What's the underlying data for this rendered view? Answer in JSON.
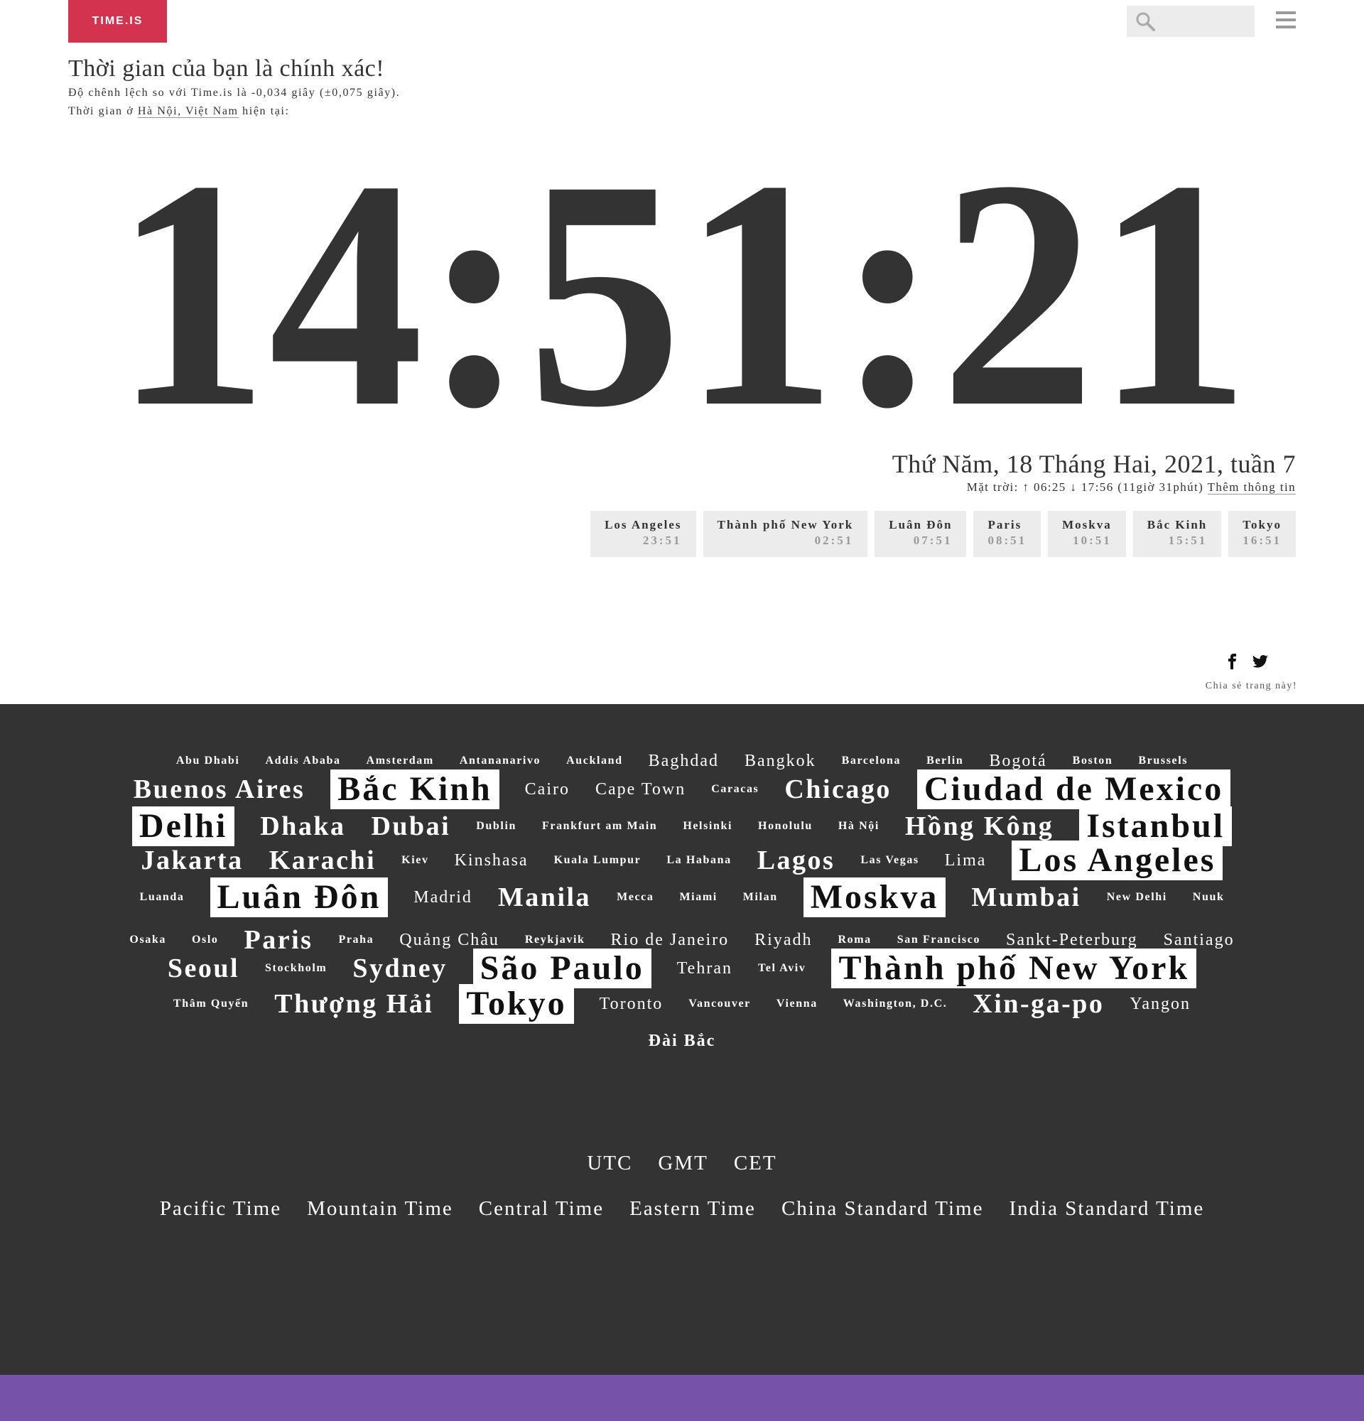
{
  "header": {
    "logo_text": "TIME.IS",
    "search_placeholder": ""
  },
  "status": {
    "title": "Thời gian của bạn là chính xác!",
    "offset_text": "Độ chênh lệch so với Time.is là -0,034 giây (±0,075 giây).",
    "location_prefix": "Thời gian ở",
    "location_link": "Hà Nội, Việt Nam",
    "location_suffix": "hiện tại:"
  },
  "clock": {
    "time": "14:51:21"
  },
  "date": {
    "date_text": "Thứ Năm, 18 Tháng Hai, 2021, tuần 7",
    "sun_text": "Mặt trời: ↑ 06:25 ↓ 17:56 (11giờ 31phút)",
    "more_info": "Thêm thông tin"
  },
  "world_clocks": [
    {
      "name": "Los Angeles",
      "time": "23:51"
    },
    {
      "name": "Thành phố New York",
      "time": "02:51"
    },
    {
      "name": "Luân Đôn",
      "time": "07:51"
    },
    {
      "name": "Paris",
      "time": "08:51"
    },
    {
      "name": "Moskva",
      "time": "10:51"
    },
    {
      "name": "Bắc Kinh",
      "time": "15:51"
    },
    {
      "name": "Tokyo",
      "time": "16:51"
    }
  ],
  "share": {
    "label": "Chia sẻ trang này!"
  },
  "city_cloud": {
    "rows": [
      [
        [
          "Abu Dhabi",
          "s1"
        ],
        [
          "Addis Ababa",
          "s1"
        ],
        [
          "Amsterdam",
          "s1"
        ],
        [
          "Antananarivo",
          "s1"
        ],
        [
          "Auckland",
          "s1"
        ],
        [
          "Baghdad",
          "s2"
        ],
        [
          "Bangkok",
          "s2"
        ],
        [
          "Barcelona",
          "s1"
        ],
        [
          "Berlin",
          "s1"
        ],
        [
          "Bogotá",
          "s2"
        ],
        [
          "Boston",
          "s1"
        ],
        [
          "Brussels",
          "s1"
        ]
      ],
      [
        [
          "Buenos Aires",
          "s3"
        ],
        [
          "Bắc Kinh",
          "big"
        ],
        [
          "Cairo",
          "s2"
        ],
        [
          "Cape Town",
          "s2"
        ],
        [
          "Caracas",
          "s1"
        ],
        [
          "Chicago",
          "s3"
        ],
        [
          "Ciudad de Mexico",
          "big"
        ]
      ],
      [
        [
          "Delhi",
          "big"
        ],
        [
          "Dhaka",
          "s3"
        ],
        [
          "Dubai",
          "s3"
        ],
        [
          "Dublin",
          "s1"
        ],
        [
          "Frankfurt am Main",
          "s1"
        ],
        [
          "Helsinki",
          "s1"
        ],
        [
          "Honolulu",
          "s1"
        ],
        [
          "Hà Nội",
          "s1"
        ],
        [
          "Hồng Kông",
          "s3"
        ],
        [
          "Istanbul",
          "big"
        ]
      ],
      [
        [
          "Jakarta",
          "s3"
        ],
        [
          "Karachi",
          "s3"
        ],
        [
          "Kiev",
          "s1"
        ],
        [
          "Kinshasa",
          "s2"
        ],
        [
          "Kuala Lumpur",
          "s1"
        ],
        [
          "La Habana",
          "s1"
        ],
        [
          "Lagos",
          "s3"
        ],
        [
          "Las Vegas",
          "s1"
        ],
        [
          "Lima",
          "s2"
        ],
        [
          "Los Angeles",
          "big"
        ]
      ],
      [
        [
          "Luanda",
          "s1"
        ],
        [
          "Luân Đôn",
          "big"
        ],
        [
          "Madrid",
          "s2"
        ],
        [
          "Manila",
          "s3"
        ],
        [
          "Mecca",
          "s1"
        ],
        [
          "Miami",
          "s1"
        ],
        [
          "Milan",
          "s1"
        ],
        [
          "Moskva",
          "big"
        ],
        [
          "Mumbai",
          "s3"
        ],
        [
          "New Delhi",
          "s1"
        ],
        [
          "Nuuk",
          "s1"
        ]
      ],
      [
        [
          "Osaka",
          "s1"
        ],
        [
          "Oslo",
          "s1"
        ],
        [
          "Paris",
          "s3"
        ],
        [
          "Praha",
          "s1"
        ],
        [
          "Quảng Châu",
          "s2"
        ],
        [
          "Reykjavik",
          "s1"
        ],
        [
          "Rio de Janeiro",
          "s2"
        ],
        [
          "Riyadh",
          "s2"
        ],
        [
          "Roma",
          "s1"
        ],
        [
          "San Francisco",
          "s1"
        ],
        [
          "Sankt-Peterburg",
          "s2"
        ],
        [
          "Santiago",
          "s2"
        ]
      ],
      [
        [
          "Seoul",
          "s3"
        ],
        [
          "Stockholm",
          "s1"
        ],
        [
          "Sydney",
          "s3"
        ],
        [
          "São Paulo",
          "big"
        ],
        [
          "Tehran",
          "s2"
        ],
        [
          "Tel Aviv",
          "s1"
        ],
        [
          "Thành phố New York",
          "big"
        ]
      ],
      [
        [
          "Thâm Quyến",
          "s1"
        ],
        [
          "Thượng Hải",
          "s3"
        ],
        [
          "Tokyo",
          "big"
        ],
        [
          "Toronto",
          "s2"
        ],
        [
          "Vancouver",
          "s1"
        ],
        [
          "Vienna",
          "s1"
        ],
        [
          "Washington, D.C.",
          "s1"
        ],
        [
          "Xin-ga-po",
          "s3"
        ],
        [
          "Yangon",
          "s2"
        ]
      ],
      [
        [
          "Đài Bắc",
          "s2b"
        ]
      ]
    ]
  },
  "timezones": {
    "row1": [
      "UTC",
      "GMT",
      "CET"
    ],
    "row2": [
      "Pacific Time",
      "Mountain Time",
      "Central Time",
      "Eastern Time",
      "China Standard Time",
      "India Standard Time"
    ]
  },
  "colors": {
    "logo_bg": "#d3334e",
    "dark_bg": "#333333",
    "footer_bar": "#7652a8"
  }
}
